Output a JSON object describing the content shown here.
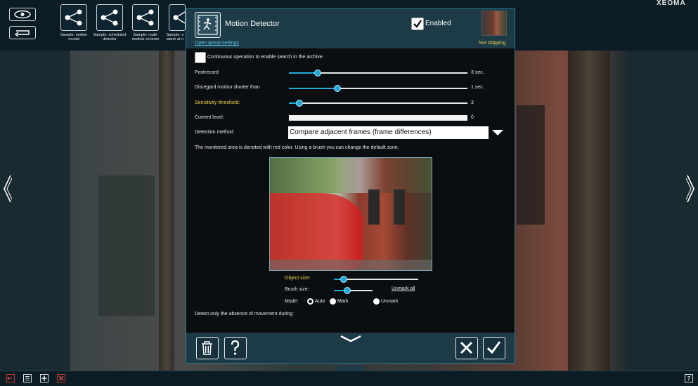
{
  "brand": {
    "logo_text": "XEOMA"
  },
  "samples": [
    {
      "label": "Sample: motion record"
    },
    {
      "label": "Sample: scheduled detector"
    },
    {
      "label": "Sample: multi-module scheme"
    },
    {
      "label": "Sample: s alarm at n"
    }
  ],
  "dialog": {
    "title": "Motion Detector",
    "group_settings_link": "Open group settings",
    "enabled_label": "Enabled",
    "enabled": true,
    "preview_status": "Not skipping",
    "continuous_label": "Continuous operation to enable search in the archive.",
    "continuous_checked": false,
    "settings": [
      {
        "label": "Postrecord",
        "value": "3 sec.",
        "level": 0.16,
        "highlight": false
      },
      {
        "label": "Disregard motion shorter than",
        "value": "1 sec.",
        "level": 0.27,
        "highlight": false
      },
      {
        "label": "Sensitivity threshold:",
        "value": "3",
        "level": 0.06,
        "highlight": true
      },
      {
        "label": "Current level:",
        "value": "0",
        "level": 0,
        "highlight": false
      }
    ],
    "detection_method_label": "Detection method",
    "detection_method_value": "Compare adjacent frames (frame differences)",
    "area_hint": "The monitored area is denoted with red color. Using a brush you can change the default zone.",
    "object_size_label": "Object size:",
    "object_size_level": 0.12,
    "brush_size_label": "Brush size:",
    "brush_size_level": 0.35,
    "unmark_all_label": "Unmark all",
    "mode_label": "Mode:",
    "modes": [
      {
        "label": "Auto",
        "selected": true
      },
      {
        "label": "Mark",
        "selected": false
      },
      {
        "label": "Unmark",
        "selected": false
      }
    ],
    "absence_label": "Detect only the absence of movement during:"
  },
  "colors": {
    "accent": "#23a8d8",
    "highlight": "#f1d24d",
    "zone": "#e01a1a",
    "panel": "#1c3b47"
  }
}
